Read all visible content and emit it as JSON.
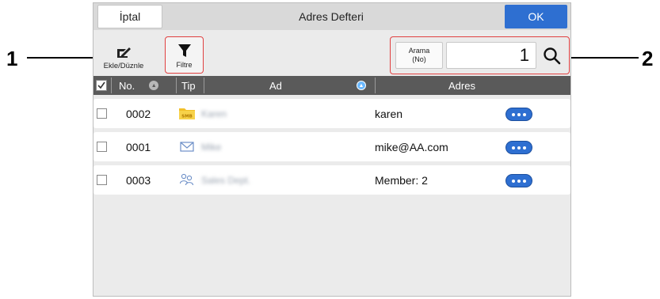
{
  "callouts": [
    "1",
    "2"
  ],
  "header": {
    "cancel_label": "İptal",
    "title": "Adres Defteri",
    "ok_label": "OK"
  },
  "toolbar": {
    "edit_label": "Ekle/Düznle",
    "filter_label": "Filtre"
  },
  "search": {
    "label_line1": "Arama",
    "label_line2": "(No)",
    "value": "1"
  },
  "table": {
    "columns": {
      "no": "No.",
      "type": "Tip",
      "name": "Ad",
      "address": "Adres"
    },
    "rows": [
      {
        "no": "0002",
        "type_icon": "smb-folder-icon",
        "type_text": "SMB",
        "name": "Karen",
        "address": "karen"
      },
      {
        "no": "0001",
        "type_icon": "email-icon",
        "name": "Mike",
        "address": "mike@AA.com"
      },
      {
        "no": "0003",
        "type_icon": "group-icon",
        "name": "Sales Dept.",
        "address": "Member: 2"
      }
    ]
  },
  "colors": {
    "accent": "#2e6fd1",
    "highlight": "#e04040",
    "header_bg": "#5a5a5a"
  }
}
